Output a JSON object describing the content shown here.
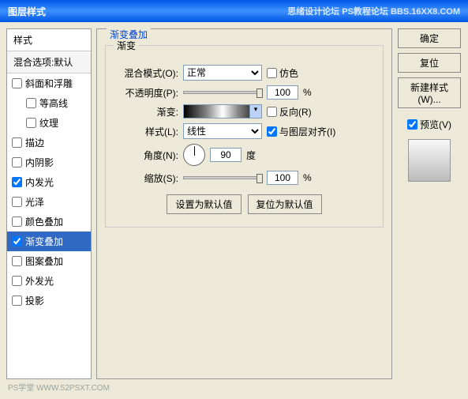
{
  "titlebar": {
    "title": "图层样式",
    "rightText": "思绪设计论坛  PS教程论坛  BBS.16XX8.COM"
  },
  "stylesPanel": {
    "header": "样式",
    "subheader": "混合选项:默认",
    "items": [
      {
        "label": "斜面和浮雕",
        "checked": false,
        "indent": false
      },
      {
        "label": "等高线",
        "checked": false,
        "indent": true
      },
      {
        "label": "纹理",
        "checked": false,
        "indent": true
      },
      {
        "label": "描边",
        "checked": false,
        "indent": false
      },
      {
        "label": "内阴影",
        "checked": false,
        "indent": false
      },
      {
        "label": "内发光",
        "checked": true,
        "indent": false
      },
      {
        "label": "光泽",
        "checked": false,
        "indent": false
      },
      {
        "label": "颜色叠加",
        "checked": false,
        "indent": false
      },
      {
        "label": "渐变叠加",
        "checked": true,
        "indent": false,
        "selected": true
      },
      {
        "label": "图案叠加",
        "checked": false,
        "indent": false
      },
      {
        "label": "外发光",
        "checked": false,
        "indent": false
      },
      {
        "label": "投影",
        "checked": false,
        "indent": false
      }
    ]
  },
  "main": {
    "sectionTitle": "渐变叠加",
    "groupTitle": "渐变",
    "blendMode": {
      "label": "混合模式(O):",
      "value": "正常",
      "dither": "仿色"
    },
    "opacity": {
      "label": "不透明度(P):",
      "value": "100",
      "unit": "%"
    },
    "gradient": {
      "label": "渐变:",
      "reverse": "反向(R)"
    },
    "style": {
      "label": "样式(L):",
      "value": "线性",
      "align": "与图层对齐(I)"
    },
    "angle": {
      "label": "角度(N):",
      "value": "90",
      "unit": "度"
    },
    "scale": {
      "label": "缩放(S):",
      "value": "100",
      "unit": "%"
    },
    "buttons": {
      "setDefault": "设置为默认值",
      "resetDefault": "复位为默认值"
    }
  },
  "side": {
    "ok": "确定",
    "cancel": "复位",
    "newStyle": "新建样式(W)...",
    "preview": "预览(V)"
  },
  "watermark": "PS学堂  WWW.52PSXT.COM"
}
